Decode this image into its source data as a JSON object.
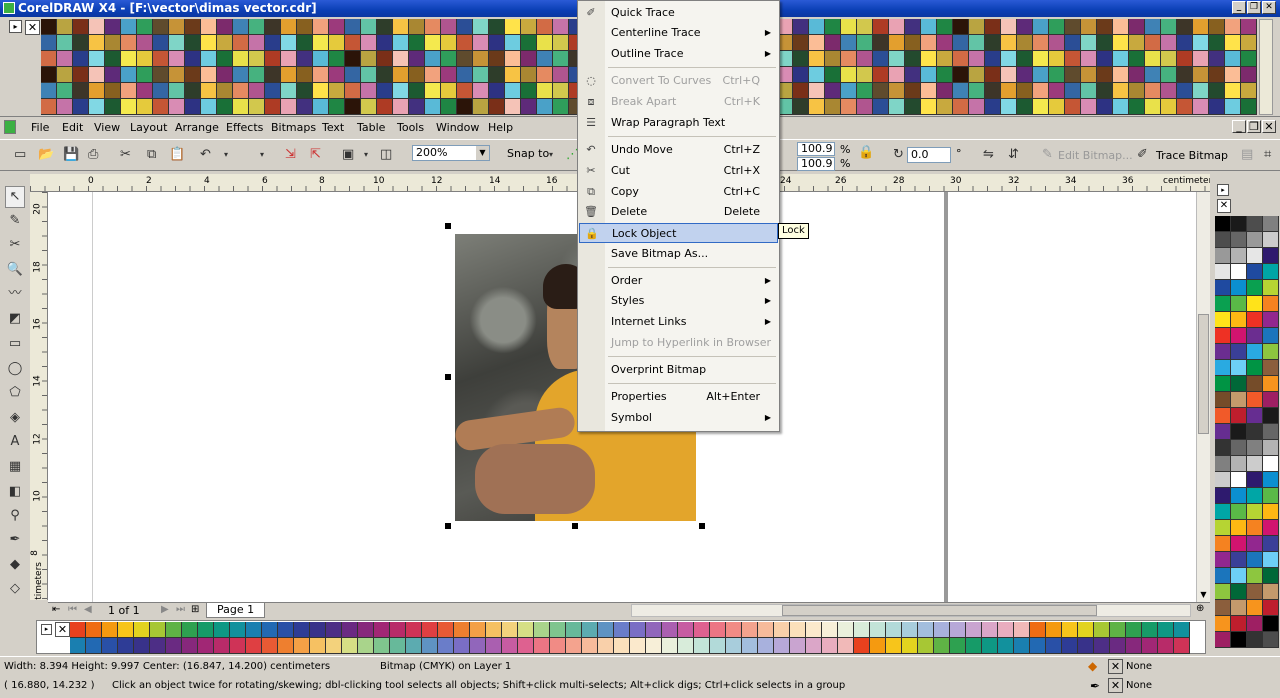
{
  "window": {
    "title": "CorelDRAW X4 - [F:\\vector\\dimas vector.cdr]"
  },
  "colors": {
    "titlebar": "#0b3fb5",
    "menu_highlight": "#c1d2ee",
    "top_palette": [
      "#2b1408",
      "#e9e14a",
      "#f4e94e",
      "#ffe34a",
      "#f7c344",
      "#e39f2e",
      "#c69337",
      "#b9a441",
      "#d2c84d",
      "#e5ca3c",
      "#c8a93e",
      "#a98732",
      "#87601f",
      "#6b3a1a",
      "#7a2f18",
      "#ae3b24",
      "#c55635",
      "#d26b45",
      "#e58a61",
      "#f2a27d",
      "#fbbd96",
      "#f5c3b7",
      "#e9a2b3",
      "#d98cb4",
      "#c573a8",
      "#b0558f",
      "#9c3a7c",
      "#7c2a6c",
      "#5e2a79",
      "#42307f",
      "#2d3283",
      "#293d8b",
      "#2b4e96",
      "#3466a3",
      "#3f82b5",
      "#4aa1c8",
      "#59bad7",
      "#6dcce0",
      "#81d8e4",
      "#7fd5c7",
      "#62c4a6",
      "#46b27f",
      "#2f9e5b",
      "#1f8644",
      "#197037",
      "#1c5a31",
      "#234a2e",
      "#2e3d2a",
      "#3d3528",
      "#5f4b2d"
    ],
    "bottom_palette": [
      "#e8411e",
      "#ef6c13",
      "#f59a10",
      "#f7c51b",
      "#e2d31f",
      "#a7c734",
      "#5fb345",
      "#2ea150",
      "#169b68",
      "#0e9884",
      "#12919d",
      "#1a7fb0",
      "#2269b3",
      "#2950a7",
      "#2e3c96",
      "#38328a",
      "#4d2e86",
      "#6a2a82",
      "#87287c",
      "#a12775",
      "#b82b69",
      "#cf3357",
      "#df3f42",
      "#e85a34",
      "#ee7f2f",
      "#f4a046",
      "#f6c162",
      "#f3d27c",
      "#d6df85",
      "#a9d48b",
      "#7fc58e",
      "#67b99a",
      "#5cabb0",
      "#5f93c3",
      "#6a7dc9",
      "#7a6ec5",
      "#9166bb",
      "#aa5fb0",
      "#c75ca2",
      "#de6190",
      "#ec7584",
      "#f18b85",
      "#f4a38e",
      "#f7bb9b",
      "#f9d0aa",
      "#fbe0bb",
      "#fbe9cc",
      "#f7efd8",
      "#eaf0dc",
      "#d8ecda",
      "#c3e4d8",
      "#b2dad9",
      "#a8cddc",
      "#a3bede",
      "#a8b1dd",
      "#b7a8d8",
      "#c9a4d0",
      "#dba6c8",
      "#e9adbf",
      "#f1b9b8"
    ],
    "right_palette": [
      "#000000",
      "#1a1a1a",
      "#333333",
      "#4d4d4d",
      "#666666",
      "#808080",
      "#999999",
      "#b3b3b3",
      "#cccccc",
      "#e6e6e6",
      "#ffffff",
      "#2e1a6e",
      "#1f4aa0",
      "#0b8fd0",
      "#00a6a6",
      "#0aa050",
      "#5ab947",
      "#b6d433",
      "#ffe31a",
      "#fdb813",
      "#f58220",
      "#ee3124",
      "#d1146f",
      "#92278f",
      "#6b2d90",
      "#3a3f98",
      "#1b75bc",
      "#29aae1",
      "#6dcff6",
      "#8dc63f",
      "#009444",
      "#006838",
      "#8b5e3c",
      "#754c29",
      "#c49a6c",
      "#f7941d",
      "#f15a29",
      "#be1e2d",
      "#9e1f63",
      "#662d91"
    ]
  },
  "menubar": {
    "items": [
      {
        "label": "File"
      },
      {
        "label": "Edit"
      },
      {
        "label": "View"
      },
      {
        "label": "Layout"
      },
      {
        "label": "Arrange"
      },
      {
        "label": "Effects"
      },
      {
        "label": "Bitmaps"
      },
      {
        "label": "Text"
      },
      {
        "label": "Table"
      },
      {
        "label": "Tools"
      },
      {
        "label": "Window"
      },
      {
        "label": "Help"
      }
    ]
  },
  "toolbar": {
    "zoom": "200%",
    "snap_to": "Snap to",
    "scale_x": "100.9",
    "scale_y": "100.9",
    "percent": "%",
    "rotation": "0.0",
    "degree": "°",
    "edit_bitmap": "Edit Bitmap...",
    "trace_bitmap": "Trace Bitmap"
  },
  "ruler": {
    "units": "centimeters",
    "h_ticks": [
      "0",
      "2",
      "4",
      "6",
      "8",
      "10",
      "12",
      "14",
      "16",
      "24",
      "26",
      "28",
      "30",
      "32",
      "34",
      "36"
    ],
    "v_ticks": [
      "20",
      "18",
      "16",
      "14",
      "12",
      "10",
      "8"
    ],
    "v_units": "centimeters"
  },
  "page_nav": {
    "page_count": "1 of 1",
    "page_tab": "Page 1"
  },
  "context_menu": {
    "items": [
      {
        "label": "Quick Trace",
        "icon": "quick-trace-icon"
      },
      {
        "label": "Centerline Trace",
        "submenu": true
      },
      {
        "label": "Outline Trace",
        "submenu": true
      },
      {
        "label": "Convert To Curves",
        "shortcut": "Ctrl+Q",
        "disabled": true,
        "icon": "convert-curves-icon"
      },
      {
        "label": "Break Apart",
        "shortcut": "Ctrl+K",
        "disabled": true,
        "icon": "break-apart-icon"
      },
      {
        "label": "Wrap Paragraph Text",
        "icon": "wrap-text-icon"
      },
      {
        "label": "Undo Move",
        "shortcut": "Ctrl+Z",
        "icon": "undo-icon"
      },
      {
        "label": "Cut",
        "shortcut": "Ctrl+X",
        "icon": "cut-icon"
      },
      {
        "label": "Copy",
        "shortcut": "Ctrl+C",
        "icon": "copy-icon"
      },
      {
        "label": "Delete",
        "shortcut": "Delete",
        "icon": "trash-icon"
      },
      {
        "label": "Lock Object",
        "selected": true,
        "icon": "lock-icon"
      },
      {
        "label": "Save Bitmap As..."
      },
      {
        "label": "Order",
        "submenu": true
      },
      {
        "label": "Styles",
        "submenu": true
      },
      {
        "label": "Internet Links",
        "submenu": true
      },
      {
        "label": "Jump to Hyperlink in Browser",
        "disabled": true
      },
      {
        "label": "Overprint Bitmap"
      },
      {
        "label": "Properties",
        "shortcut": "Alt+Enter"
      },
      {
        "label": "Symbol",
        "submenu": true
      }
    ]
  },
  "tooltip": "Lock",
  "status": {
    "dimensions": "Width: 8.394  Height: 9.997  Center: (16.847, 14.200)  centimeters",
    "object_info": "Bitmap (CMYK) on Layer 1",
    "fill": "None",
    "outline": "None",
    "cursor": "( 16.880, 14.232 )",
    "hint": "Click an object twice for rotating/skewing; dbl-clicking tool selects all objects; Shift+click multi-selects; Alt+click digs; Ctrl+click selects in a group"
  }
}
